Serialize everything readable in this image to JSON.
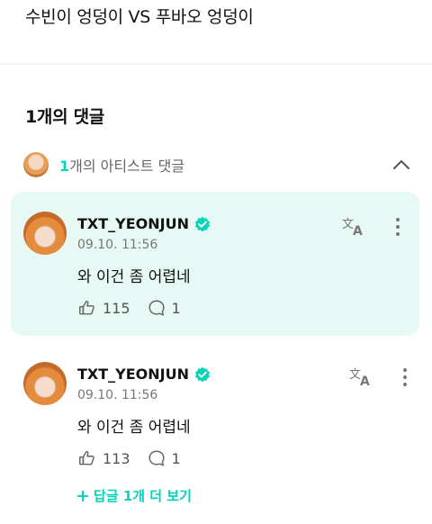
{
  "post": {
    "title": "수빈이 엉덩이 VS 푸바오 엉덩이"
  },
  "comments_header": {
    "count_label": "1개의 댓글"
  },
  "artist_summary": {
    "count": "1",
    "label": "개의 아티스트 댓글"
  },
  "comments": [
    {
      "author": "TXT_YEONJUN",
      "time": "09.10. 11:56",
      "text": "와 이건 좀 어렵네",
      "likes": "115",
      "replies": "1"
    },
    {
      "author": "TXT_YEONJUN",
      "time": "09.10. 11:56",
      "text": "와 이건 좀 어렵네",
      "likes": "113",
      "replies": "1",
      "more_replies_label": "답글 1개 더 보기"
    }
  ],
  "colors": {
    "accent": "#07d3b8",
    "highlight_bg": "#e6f9f5",
    "verified": "#07d3b8"
  },
  "icons": [
    "chevron-up-icon",
    "verified-icon",
    "translate-icon",
    "more-vertical-icon",
    "like-icon",
    "reply-icon",
    "plus-icon"
  ]
}
